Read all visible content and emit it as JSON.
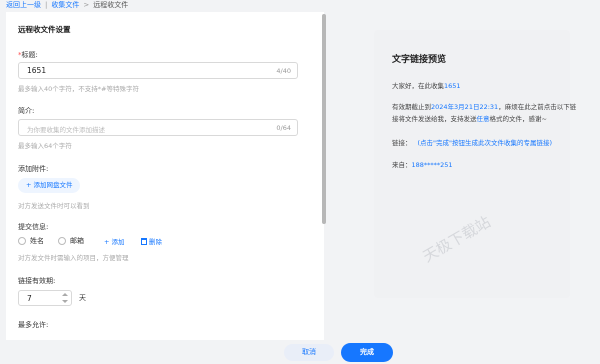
{
  "breadcrumb": {
    "back": "返回上一级",
    "parent": "收集文件",
    "current": "远程收文件"
  },
  "form": {
    "section_title": "远程收文件设置",
    "title": {
      "required_mark": "*",
      "label": "标题:",
      "value": "1651",
      "counter": "4/40",
      "hint": "最多输入40个字符，不支持*#等特殊字符"
    },
    "intro": {
      "label": "简介:",
      "placeholder": "为你要收集的文件添加描述",
      "counter": "0/64",
      "hint": "最多输入64个字符"
    },
    "attachment": {
      "label": "添加附件:",
      "button": "添加网盘文件",
      "hint": "对方发送文件时可以看到"
    },
    "submit_info": {
      "label": "提交信息:",
      "options": [
        "姓名",
        "邮箱"
      ],
      "add": "+ 添加",
      "delete": "删除",
      "hint": "对方发文件时需输入的项目，方便管理"
    },
    "validity": {
      "label": "链接有效期:",
      "value": "7",
      "unit": "天"
    },
    "max_allowed": {
      "label": "最多允许:"
    }
  },
  "preview": {
    "title": "文字链接预览",
    "greeting_prefix": "大家好，在此收集",
    "greeting_name": "1651",
    "deadline_prefix": "有效期截止到",
    "deadline_value": "2024年3月21日22:31",
    "deadline_suffix": "，麻烦在此之前点击以下链",
    "line2_prefix": "接将文件发送给我，支持发送",
    "line2_any": "任意",
    "line2_suffix": "格式的文件，感谢~",
    "link_label": "链接：",
    "link_value": "(点击\"完成\"按钮生成此次文件收集的专属链接)",
    "from_label": "来自：",
    "from_value": "188*****251"
  },
  "watermark": "天极下载站",
  "footer": {
    "cancel": "取消",
    "done": "完成"
  },
  "colors": {
    "accent": "#1677ff",
    "required": "#ff4d4f"
  }
}
